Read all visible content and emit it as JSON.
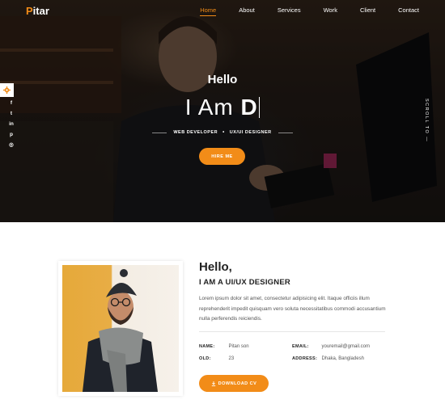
{
  "brand": {
    "logo_first": "P",
    "logo_rest": "itar"
  },
  "nav": {
    "items": [
      {
        "label": "Home",
        "active": true
      },
      {
        "label": "About"
      },
      {
        "label": "Services"
      },
      {
        "label": "Work"
      },
      {
        "label": "Client"
      },
      {
        "label": "Contact"
      }
    ]
  },
  "hero": {
    "greeting": "Hello",
    "iam_prefix": "I Am ",
    "iam_typed": "D",
    "roles": [
      "WEB DEVELOPER",
      "UX/UI DESIGNER"
    ],
    "separator": "•",
    "hire_label": "HIRE ME",
    "scroll_label": "SCROLL TO —"
  },
  "socials": [
    {
      "icon": "facebook-icon",
      "glyph": "f"
    },
    {
      "icon": "twitter-icon",
      "glyph": "t"
    },
    {
      "icon": "linkedin-icon",
      "glyph": "in"
    },
    {
      "icon": "pinterest-icon",
      "glyph": "p"
    },
    {
      "icon": "instagram-icon",
      "glyph": "◎"
    }
  ],
  "about": {
    "hello": "Hello,",
    "role": "I AM A UI/UX DESIGNER",
    "text": "Lorem ipsum dolor sit amet, consectetur adipisicing elit. Itaque officiis illum reprehenderit impedit quisquam vero soluta necessitatibus commodi accusantium nulla perferendis reiciendis.",
    "info": {
      "name_label": "NAME:",
      "name_value": "Pitan son",
      "email_label": "EMAIL:",
      "email_value": "youremail@gmail.com",
      "old_label": "OLD:",
      "old_value": "23",
      "address_label": "ADDRESS:",
      "address_value": "Dhaka, Bangladesh"
    },
    "download_label": "DOWNLOAD CV"
  },
  "colors": {
    "accent": "#f28c18",
    "text_dark": "#222222",
    "text_muted": "#555555"
  }
}
